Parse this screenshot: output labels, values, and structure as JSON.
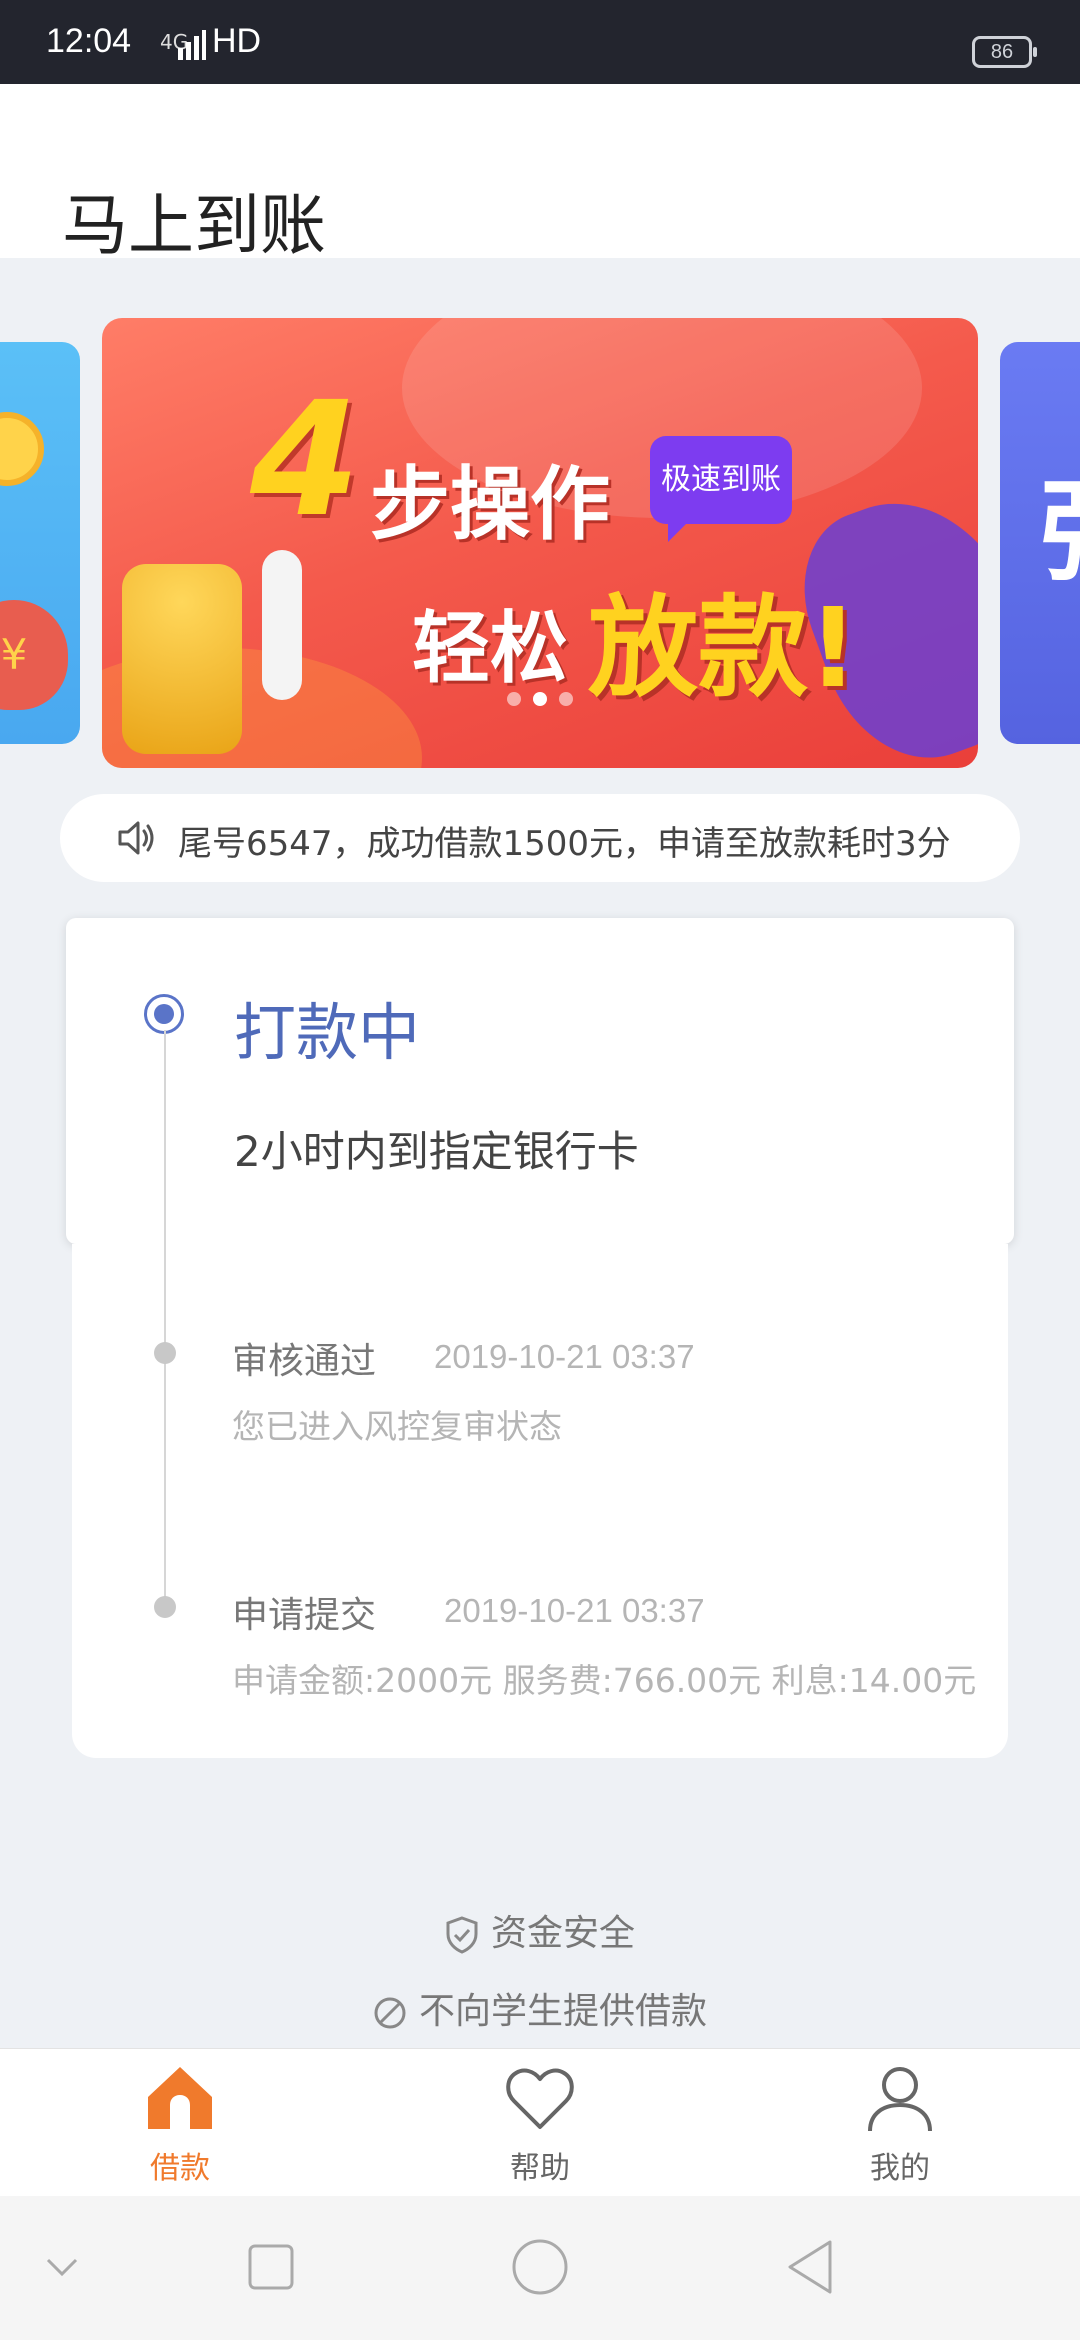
{
  "status_bar": {
    "time": "12:04",
    "network": "4G",
    "hd": "HD",
    "battery": "86"
  },
  "page": {
    "title": "马上到账"
  },
  "banner": {
    "big_number": "4",
    "line1": "步操作",
    "line2_a": "轻松",
    "line2_b": "放款!",
    "tag": "极速到账",
    "side_right_char": "强",
    "side_left_symbol": "¥"
  },
  "notice": {
    "text": "尾号6547，成功借款1500元，申请至放款耗时3分"
  },
  "status": {
    "title": "打款中",
    "subtitle": "2小时内到指定银行卡"
  },
  "history": [
    {
      "title": "审核通过",
      "time": "2019-10-21 03:37",
      "desc": "您已进入风控复审状态"
    },
    {
      "title": "申请提交",
      "time": "2019-10-21 03:37",
      "desc": "申请金额:2000元  服务费:766.00元 利息:14.00元"
    }
  ],
  "footer": {
    "safety": "资金安全",
    "no_students": "不向学生提供借款"
  },
  "tabbar": [
    {
      "label": "借款",
      "icon": "home-icon",
      "active": true
    },
    {
      "label": "帮助",
      "icon": "heart-icon",
      "active": false
    },
    {
      "label": "我的",
      "icon": "user-icon",
      "active": false
    }
  ],
  "colors": {
    "accent": "#5a74c8",
    "tab_active": "#f07a2c",
    "banner_red": "#f45a4c",
    "banner_yellow": "#ffd21f"
  }
}
